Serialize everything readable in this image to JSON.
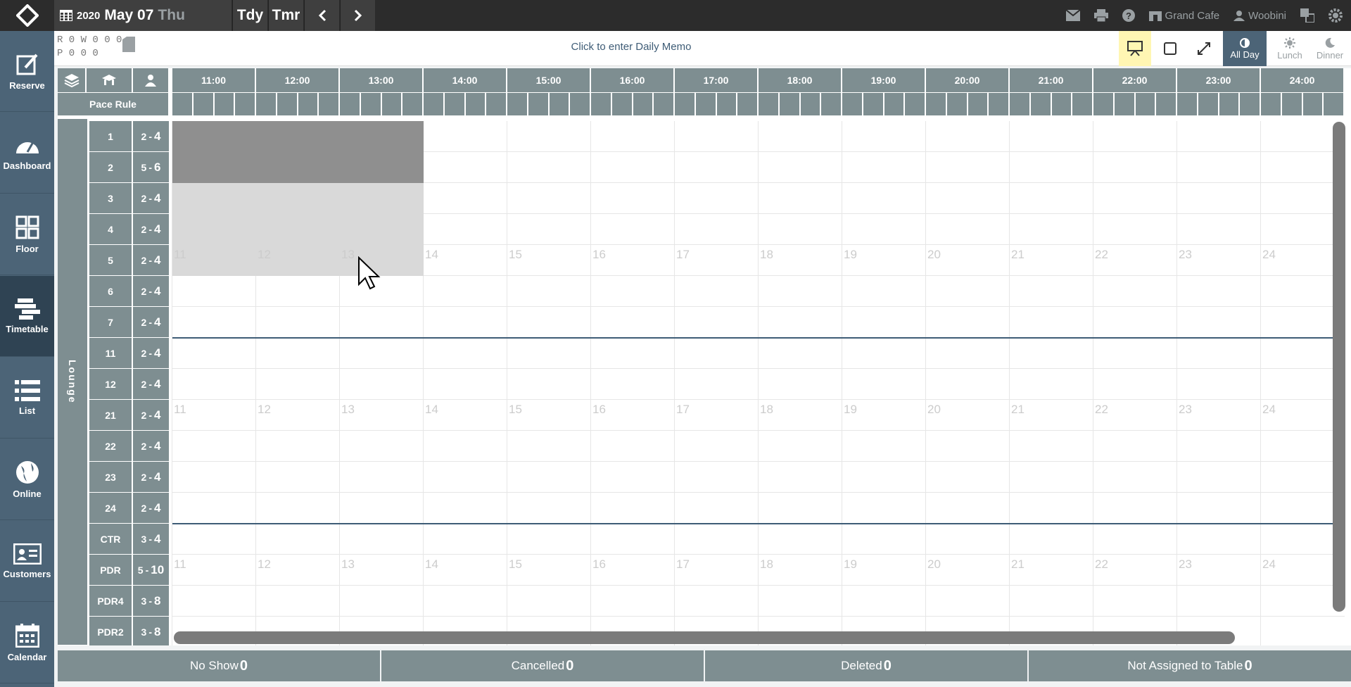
{
  "header": {
    "year": "2020",
    "month_day": "May 07",
    "weekday": "Thu",
    "today_label": "Tdy",
    "tomorrow_label": "Tmr",
    "restaurant": "Grand Cafe",
    "user": "Woobini"
  },
  "sidebar": {
    "items": [
      {
        "label": "Reserve",
        "icon": "reserve-icon"
      },
      {
        "label": "Dashboard",
        "icon": "dashboard-icon"
      },
      {
        "label": "Floor",
        "icon": "floor-icon"
      },
      {
        "label": "Timetable",
        "icon": "timetable-icon"
      },
      {
        "label": "List",
        "icon": "list-icon"
      },
      {
        "label": "Online",
        "icon": "globe-icon"
      },
      {
        "label": "Customers",
        "icon": "customers-icon"
      },
      {
        "label": "Calendar",
        "icon": "calendar-icon"
      }
    ],
    "active": "Timetable"
  },
  "counts": {
    "line1": "R 0 W 0 0 0",
    "line2": "P 0  0  0"
  },
  "memo": "Click to enter Daily Memo",
  "view": {
    "all_day": "All Day",
    "lunch": "Lunch",
    "dinner": "Dinner"
  },
  "timetable": {
    "pace_rule_label": "Pace Rule",
    "section_label": "Lounge",
    "hours": [
      "11:00",
      "12:00",
      "13:00",
      "14:00",
      "15:00",
      "16:00",
      "17:00",
      "18:00",
      "19:00",
      "20:00",
      "21:00",
      "22:00",
      "23:00",
      "24:00"
    ],
    "hour_marks": [
      "11",
      "12",
      "13",
      "14",
      "15",
      "16",
      "17",
      "18",
      "19",
      "20",
      "21",
      "22",
      "23",
      "24"
    ],
    "tables": [
      {
        "name": "1",
        "min": "2",
        "max": "4"
      },
      {
        "name": "2",
        "min": "5",
        "max": "6"
      },
      {
        "name": "3",
        "min": "2",
        "max": "4"
      },
      {
        "name": "4",
        "min": "2",
        "max": "4"
      },
      {
        "name": "5",
        "min": "2",
        "max": "4"
      },
      {
        "name": "6",
        "min": "2",
        "max": "4"
      },
      {
        "name": "7",
        "min": "2",
        "max": "4"
      },
      {
        "name": "11",
        "min": "2",
        "max": "4"
      },
      {
        "name": "12",
        "min": "2",
        "max": "4"
      },
      {
        "name": "21",
        "min": "2",
        "max": "4"
      },
      {
        "name": "22",
        "min": "2",
        "max": "4"
      },
      {
        "name": "23",
        "min": "2",
        "max": "4"
      },
      {
        "name": "24",
        "min": "2",
        "max": "4"
      },
      {
        "name": "CTR",
        "min": "3",
        "max": "4"
      },
      {
        "name": "PDR",
        "min": "5",
        "max": "10"
      },
      {
        "name": "PDR4",
        "min": "3",
        "max": "8"
      },
      {
        "name": "PDR2",
        "min": "3",
        "max": "8"
      }
    ]
  },
  "footer": {
    "no_show_label": "No Show",
    "no_show_count": "0",
    "cancelled_label": "Cancelled",
    "cancelled_count": "0",
    "deleted_label": "Deleted",
    "deleted_count": "0",
    "not_assigned_label": "Not Assigned to Table",
    "not_assigned_count": "0"
  },
  "colors": {
    "topbar": "#2c2c2c",
    "sidebar": "#4c6477",
    "header_gray": "#7e8e91",
    "blocked_dark": "#8f8f8f",
    "blocked_light": "#d9d9d9"
  }
}
